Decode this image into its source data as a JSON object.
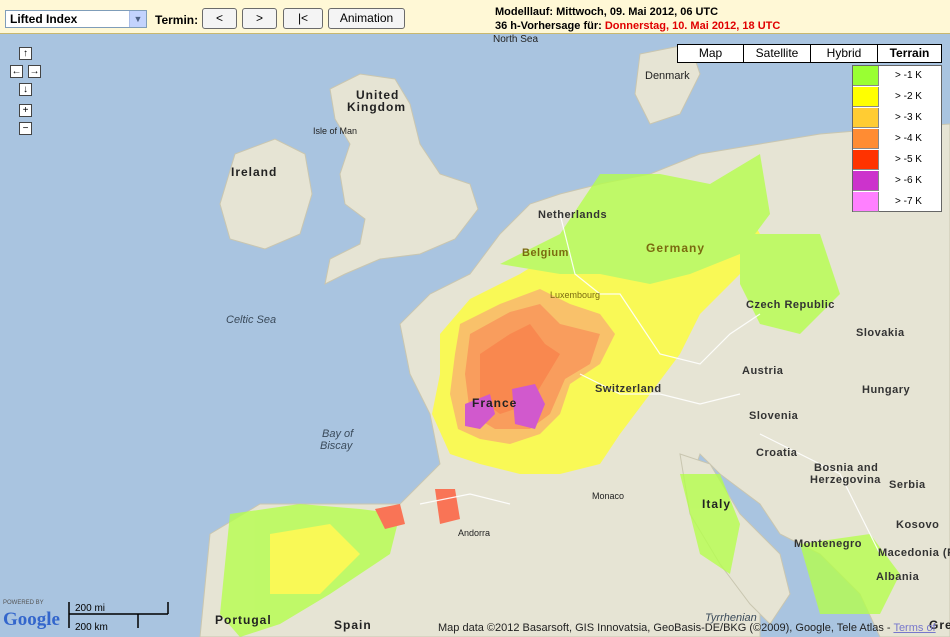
{
  "toolbar": {
    "select_value": "Lifted Index",
    "termin_label": "Termin:",
    "prev_label": "<",
    "next_label": ">",
    "first_label": "|<",
    "animation_label": "Animation"
  },
  "info": {
    "line1": "Modelllauf: Mittwoch, 09. Mai 2012, 06 UTC",
    "line2_prefix": "36 h-Vorhersage für:",
    "line2_date": "Donnerstag, 10. Mai 2012, 18 UTC"
  },
  "map_controls": {
    "pan_up": "↑",
    "pan_left": "←",
    "pan_right": "→",
    "pan_down": "↓",
    "zoom_in": "+",
    "zoom_out": "−"
  },
  "map_types": [
    "Map",
    "Satellite",
    "Hybrid",
    "Terrain"
  ],
  "active_map_type": "Terrain",
  "legend": [
    {
      "label": "> -1 K",
      "color": "#99ff33"
    },
    {
      "label": "> -2 K",
      "color": "#ffff00"
    },
    {
      "label": "> -3 K",
      "color": "#ffcc33"
    },
    {
      "label": "> -4 K",
      "color": "#ff8c33"
    },
    {
      "label": "> -5 K",
      "color": "#ff3300"
    },
    {
      "label": "> -6 K",
      "color": "#cc33cc"
    },
    {
      "label": "> -7 K",
      "color": "#ff80ff"
    }
  ],
  "places": {
    "north_sea": "North Sea",
    "denmark": "Denmark",
    "united": "United",
    "kingdom": "Kingdom",
    "isle_of_man": "Isle of Man",
    "ireland": "Ireland",
    "netherlands": "Netherlands",
    "belgium": "Belgium",
    "germany": "Germany",
    "luxembourg": "Luxembourg",
    "czech_republic": "Czech Republic",
    "slovakia": "Slovakia",
    "celtic_sea": "Celtic Sea",
    "austria": "Austria",
    "hungary": "Hungary",
    "france": "France",
    "switzerland": "Switzerland",
    "slovenia": "Slovenia",
    "bay_of": "Bay of",
    "biscay": "Biscay",
    "croatia": "Croatia",
    "bosnia": "Bosnia and",
    "herzegovina": "Herzegovina",
    "serbia": "Serbia",
    "monaco": "Monaco",
    "italy": "Italy",
    "andorra": "Andorra",
    "kosovo": "Kosovo",
    "montenegro": "Montenegro",
    "macedonia": "Macedonia (F",
    "albania": "Albania",
    "portugal": "Portugal",
    "spain": "Spain",
    "tyrrhenian": "Tyrrhenian",
    "greece": "Gre"
  },
  "branding": {
    "powered_by": "POWERED BY",
    "google": "Google"
  },
  "scale": {
    "miles": "200 mi",
    "km": "200 km"
  },
  "attribution": {
    "text": "Map data ©2012 Basarsoft, GIS Innovatsia, GeoBasis-DE/BKG (©2009), Google, Tele Atlas -",
    "terms": "Terms of"
  },
  "colors": {
    "sea": "#a9c4e0",
    "land": "#e8e6d8",
    "toolbar_bg": "#fff8d6",
    "highlight_date": "#e00000"
  }
}
